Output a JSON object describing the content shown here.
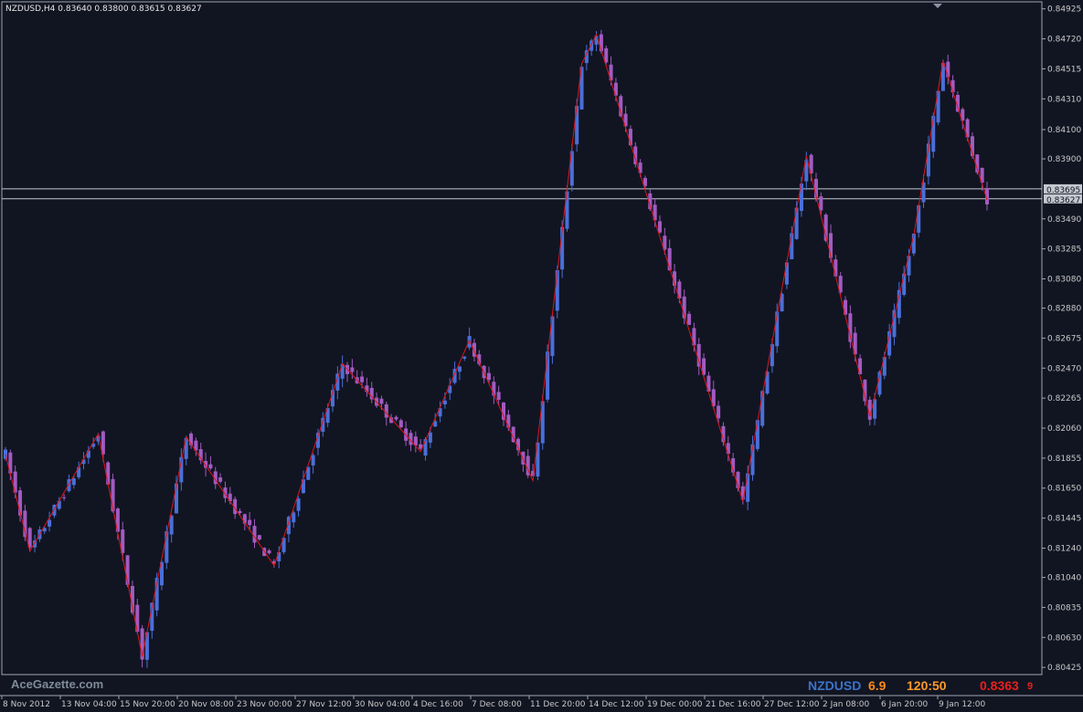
{
  "chart_data": {
    "type": "candlestick",
    "title": "NZDUSD,H4  0.83640 0.83800 0.83615 0.83627",
    "ylim": [
      0.80376,
      0.84973
    ],
    "yticks": [
      "0.84925",
      "0.84720",
      "0.84515",
      "0.84310",
      "0.84100",
      "0.83900",
      "0.83695",
      "0.83490",
      "0.83285",
      "0.83080",
      "0.82880",
      "0.82675",
      "0.82470",
      "0.82265",
      "0.82060",
      "0.81855",
      "0.81650",
      "0.81445",
      "0.81240",
      "0.81040",
      "0.80835",
      "0.80630",
      "0.80425"
    ],
    "yticks_values": [
      0.84925,
      0.8472,
      0.84515,
      0.8431,
      0.841,
      0.839,
      0.83695,
      0.8349,
      0.83285,
      0.8308,
      0.8288,
      0.82675,
      0.8247,
      0.82265,
      0.8206,
      0.81855,
      0.8165,
      0.81445,
      0.8124,
      0.8104,
      0.80835,
      0.8063,
      0.80425
    ],
    "xticks": [
      "8 Nov 2012",
      "13 Nov 04:00",
      "15 Nov 20:00",
      "20 Nov 08:00",
      "23 Nov 00:00",
      "27 Nov 12:00",
      "30 Nov 04:00",
      "4 Dec 16:00",
      "7 Dec 08:00",
      "11 Dec 20:00",
      "14 Dec 12:00",
      "19 Dec 00:00",
      "21 Dec 16:00",
      "27 Dec 12:00",
      "2 Jan 08:00",
      "6 Jan 20:00",
      "9 Jan 12:00"
    ],
    "hlines": [
      {
        "value": 0.83695,
        "label": "0.83695"
      },
      {
        "value": 0.83627,
        "label": "0.83627"
      }
    ],
    "zigzag_indices": [
      0,
      5,
      19,
      28,
      37,
      55,
      69,
      85,
      95,
      108,
      118,
      121,
      151,
      164,
      177,
      186,
      192,
      201
    ],
    "zigzag_values": [
      0.8188,
      0.8122,
      0.8202,
      0.805,
      0.82,
      0.8112,
      0.825,
      0.819,
      0.8266,
      0.817,
      0.8455,
      0.8475,
      0.8156,
      0.8392,
      0.8214,
      0.8338,
      0.8457,
      0.8362
    ],
    "candle_count": 202,
    "colors": {
      "bull": "#4a6fd8",
      "bear": "#a25bc0",
      "zigzag": "#e0151b",
      "grid": "#a0a8b0"
    }
  },
  "status": {
    "watermark": "AceGazette.com",
    "symbol": "NZDUSD",
    "spread": "6.9",
    "timer": "120:50",
    "price": "0.8363",
    "price_digit": "9"
  }
}
